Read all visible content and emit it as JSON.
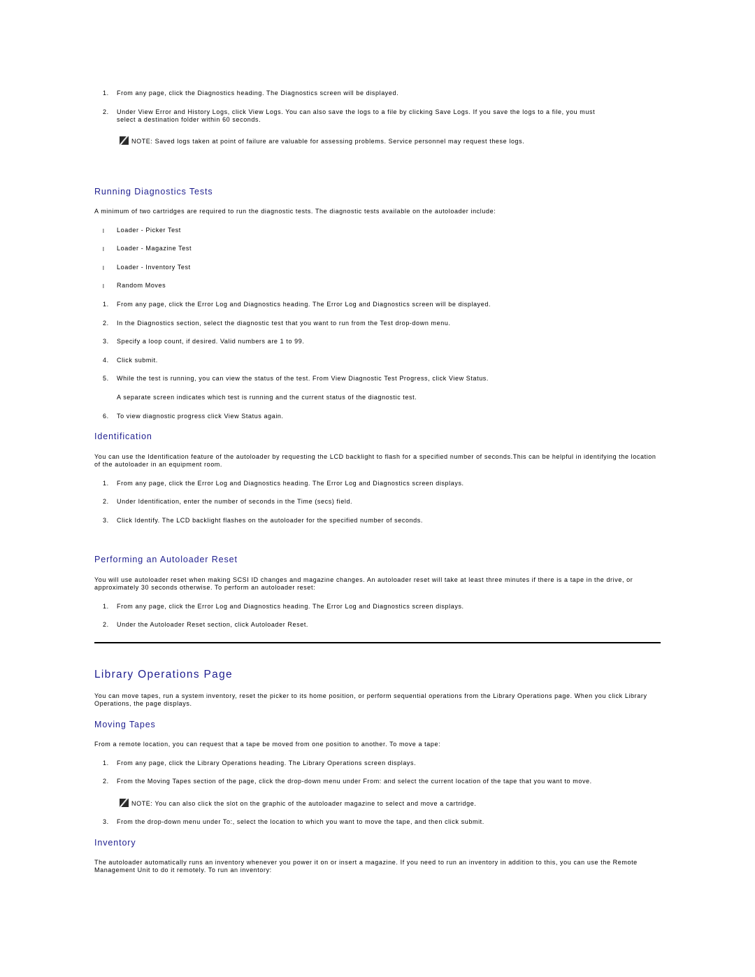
{
  "logs_steps": [
    {
      "num": "1.",
      "text": "From any page, click the Diagnostics heading. The Diagnostics screen will be displayed."
    },
    {
      "num": "2.",
      "text": "Under View Error and History Logs, click View Logs. You can also save the logs to a file by clicking Save Logs. If you save the logs to a file, you must",
      "text2": "select a destination folder within 60 seconds."
    }
  ],
  "logs_note": {
    "icon": "note-pencil-icon",
    "text": "NOTE: Saved logs taken at point of failure are valuable for assessing problems. Service personnel may request these logs."
  },
  "running_tests": {
    "heading": "Running Diagnostics Tests",
    "intro": "A minimum of two cartridges are required to run the diagnostic tests. The diagnostic tests available on the autoloader include:",
    "bullet_glyph": "l",
    "tests": [
      "Loader - Picker Test",
      "Loader - Magazine Test",
      "Loader - Inventory Test",
      "Random Moves"
    ],
    "steps": [
      {
        "num": "1.",
        "text": "From any page, click the Error Log and Diagnostics heading. The Error Log and Diagnostics screen will be displayed."
      },
      {
        "num": "2.",
        "text": "In the Diagnostics section, select the diagnostic test that you want to run from the Test drop-down menu."
      },
      {
        "num": "3.",
        "text": "Specify a loop count, if desired. Valid numbers are 1 to 99."
      },
      {
        "num": "4.",
        "text": "Click submit."
      },
      {
        "num": "5.",
        "text": "While the test is running, you can view the status of the test. From View Diagnostic Test Progress, click View Status.",
        "sub": "A separate screen indicates which test is running and the current status of the diagnostic test."
      },
      {
        "num": "6.",
        "text": "To view diagnostic progress click View Status again."
      }
    ]
  },
  "identification": {
    "heading": "Identification",
    "intro": "You can use the Identification feature of the autoloader by requesting the LCD backlight to flash for a specified number of seconds.This can be helpful in identifying the location of the autoloader in an equipment room.",
    "steps": [
      {
        "num": "1.",
        "text": "From any page, click the Error Log and Diagnostics heading. The Error Log and Diagnostics screen displays."
      },
      {
        "num": "2.",
        "text": "Under Identification, enter the number of seconds in the Time (secs) field."
      },
      {
        "num": "3.",
        "text": "Click Identify. The LCD backlight flashes on the autoloader for the specified number of seconds."
      }
    ]
  },
  "reset": {
    "heading": "Performing an Autoloader Reset",
    "intro": "You will use autoloader reset when making SCSI ID changes and magazine changes. An autoloader reset will take at least three minutes if there is a tape in the drive, or approximately 30 seconds otherwise. To perform an autoloader reset:",
    "steps": [
      {
        "num": "1.",
        "text": "From any page, click the Error Log and Diagnostics heading. The Error Log and Diagnostics screen displays."
      },
      {
        "num": "2.",
        "text": "Under the Autoloader Reset section, click Autoloader Reset."
      }
    ]
  },
  "library_ops": {
    "heading": "Library Operations Page",
    "intro": "You can move tapes, run a system inventory, reset the picker to its home position, or perform sequential operations from the Library Operations page. When you click Library Operations, the page displays."
  },
  "moving_tapes": {
    "heading": "Moving Tapes",
    "intro": "From a remote location, you can request that a tape be moved from one position to another. To move a tape:",
    "steps": [
      {
        "num": "1.",
        "text": "From any page, click the Library Operations heading. The Library Operations screen displays."
      },
      {
        "num": "2.",
        "text": "From the Moving Tapes section of the page, click the drop-down menu under From: and select the current location of the tape that you want to move."
      },
      {
        "num": "3.",
        "text": "From the drop-down menu under To:, select the location to which you want to move the tape, and then click submit."
      }
    ],
    "note": {
      "icon": "note-pencil-icon",
      "text": "NOTE: You can also click the slot on the graphic of the autoloader magazine to select and move a cartridge."
    }
  },
  "inventory": {
    "heading": "Inventory",
    "intro": "The autoloader automatically runs an inventory whenever you power it on or insert a magazine. If you need to run an inventory in addition to this, you can use the Remote Management Unit to do it remotely. To run an inventory:"
  }
}
